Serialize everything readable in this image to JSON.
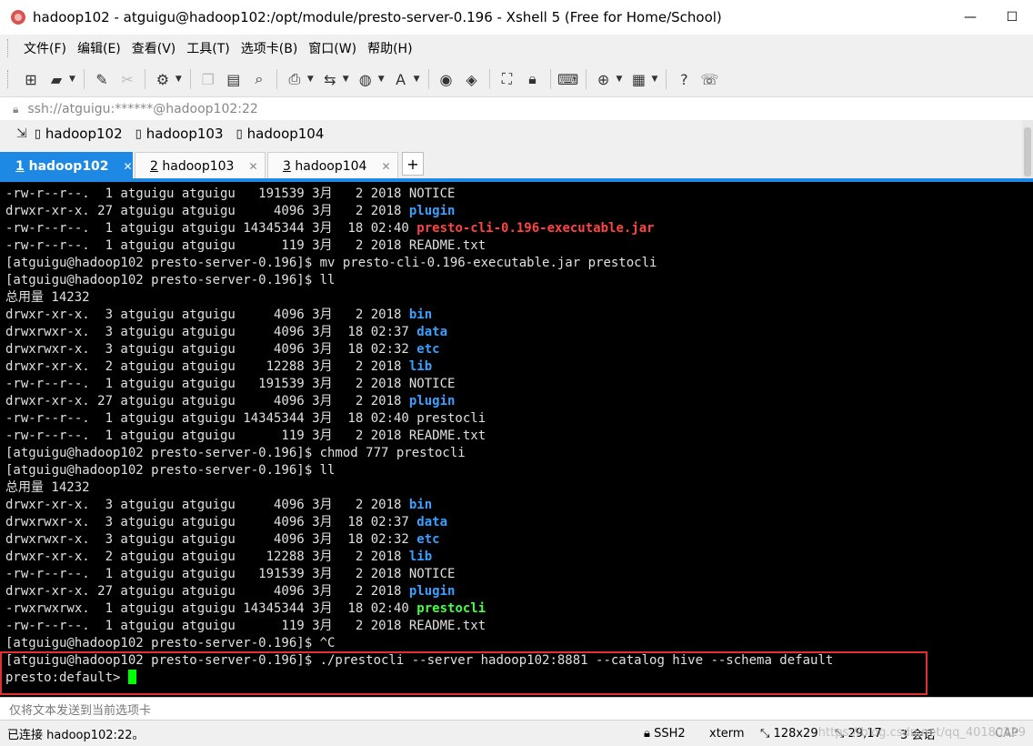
{
  "window": {
    "title": "hadoop102 - atguigu@hadoop102:/opt/module/presto-server-0.196 - Xshell 5 (Free for Home/School)",
    "minimize": "—",
    "maximize": "☐"
  },
  "menu": [
    "文件(F)",
    "编辑(E)",
    "查看(V)",
    "工具(T)",
    "选项卡(B)",
    "窗口(W)",
    "帮助(H)"
  ],
  "address": "ssh://atguigu:******@hadoop102:22",
  "quick_sessions": [
    "hadoop102",
    "hadoop103",
    "hadoop104"
  ],
  "tabs": [
    {
      "num": "1",
      "label": "hadoop102",
      "active": true
    },
    {
      "num": "2",
      "label": "hadoop103",
      "active": false
    },
    {
      "num": "3",
      "label": "hadoop104",
      "active": false
    }
  ],
  "terminal": {
    "lines": [
      [
        {
          "t": "-rw-r--r--.  1 atguigu atguigu   191539 3月   2 2018 NOTICE"
        }
      ],
      [
        {
          "t": "drwxr-xr-x. 27 atguigu atguigu     4096 3月   2 2018 "
        },
        {
          "t": "plugin",
          "c": "blue"
        }
      ],
      [
        {
          "t": "-rw-r--r--.  1 atguigu atguigu 14345344 3月  18 02:40 "
        },
        {
          "t": "presto-cli-0.196-executable.jar",
          "c": "red"
        }
      ],
      [
        {
          "t": "-rw-r--r--.  1 atguigu atguigu      119 3月   2 2018 README.txt"
        }
      ],
      [
        {
          "t": "[atguigu@hadoop102 presto-server-0.196]$ mv presto-cli-0.196-executable.jar prestocli"
        }
      ],
      [
        {
          "t": "[atguigu@hadoop102 presto-server-0.196]$ ll"
        }
      ],
      [
        {
          "t": "总用量 14232"
        }
      ],
      [
        {
          "t": "drwxr-xr-x.  3 atguigu atguigu     4096 3月   2 2018 "
        },
        {
          "t": "bin",
          "c": "blue"
        }
      ],
      [
        {
          "t": "drwxrwxr-x.  3 atguigu atguigu     4096 3月  18 02:37 "
        },
        {
          "t": "data",
          "c": "blue"
        }
      ],
      [
        {
          "t": "drwxrwxr-x.  3 atguigu atguigu     4096 3月  18 02:32 "
        },
        {
          "t": "etc",
          "c": "blue"
        }
      ],
      [
        {
          "t": "drwxr-xr-x.  2 atguigu atguigu    12288 3月   2 2018 "
        },
        {
          "t": "lib",
          "c": "blue"
        }
      ],
      [
        {
          "t": "-rw-r--r--.  1 atguigu atguigu   191539 3月   2 2018 NOTICE"
        }
      ],
      [
        {
          "t": "drwxr-xr-x. 27 atguigu atguigu     4096 3月   2 2018 "
        },
        {
          "t": "plugin",
          "c": "blue"
        }
      ],
      [
        {
          "t": "-rw-r--r--.  1 atguigu atguigu 14345344 3月  18 02:40 prestocli"
        }
      ],
      [
        {
          "t": "-rw-r--r--.  1 atguigu atguigu      119 3月   2 2018 README.txt"
        }
      ],
      [
        {
          "t": "[atguigu@hadoop102 presto-server-0.196]$ chmod 777 prestocli"
        }
      ],
      [
        {
          "t": "[atguigu@hadoop102 presto-server-0.196]$ ll"
        }
      ],
      [
        {
          "t": "总用量 14232"
        }
      ],
      [
        {
          "t": "drwxr-xr-x.  3 atguigu atguigu     4096 3月   2 2018 "
        },
        {
          "t": "bin",
          "c": "blue"
        }
      ],
      [
        {
          "t": "drwxrwxr-x.  3 atguigu atguigu     4096 3月  18 02:37 "
        },
        {
          "t": "data",
          "c": "blue"
        }
      ],
      [
        {
          "t": "drwxrwxr-x.  3 atguigu atguigu     4096 3月  18 02:32 "
        },
        {
          "t": "etc",
          "c": "blue"
        }
      ],
      [
        {
          "t": "drwxr-xr-x.  2 atguigu atguigu    12288 3月   2 2018 "
        },
        {
          "t": "lib",
          "c": "blue"
        }
      ],
      [
        {
          "t": "-rw-r--r--.  1 atguigu atguigu   191539 3月   2 2018 NOTICE"
        }
      ],
      [
        {
          "t": "drwxr-xr-x. 27 atguigu atguigu     4096 3月   2 2018 "
        },
        {
          "t": "plugin",
          "c": "blue"
        }
      ],
      [
        {
          "t": "-rwxrwxrwx.  1 atguigu atguigu 14345344 3月  18 02:40 "
        },
        {
          "t": "prestocli",
          "c": "green"
        }
      ],
      [
        {
          "t": "-rw-r--r--.  1 atguigu atguigu      119 3月   2 2018 README.txt"
        }
      ],
      [
        {
          "t": "[atguigu@hadoop102 presto-server-0.196]$ ^C"
        }
      ],
      [
        {
          "t": "[atguigu@hadoop102 presto-server-0.196]$ ./prestocli --server hadoop102:8881 --catalog hive --schema default"
        }
      ],
      [
        {
          "t": "presto:default> "
        },
        {
          "cursor": true
        }
      ]
    ]
  },
  "send_bar": "仅将文本发送到当前选项卡",
  "status": {
    "connection": "已连接 hadoop102:22。",
    "protocol": "SSH2",
    "term": "xterm",
    "size": "128x29",
    "position": "29,17",
    "sessions": "3 会话",
    "caps": "CAP",
    "watermark": "https://blog.csdn.net/qq_40180229"
  },
  "colors": {
    "accent": "#1e88e5",
    "dir_blue": "#3aa0ff",
    "archive_red": "#ff4444",
    "exec_green": "#44ff44",
    "highlight_box": "#e03030"
  }
}
